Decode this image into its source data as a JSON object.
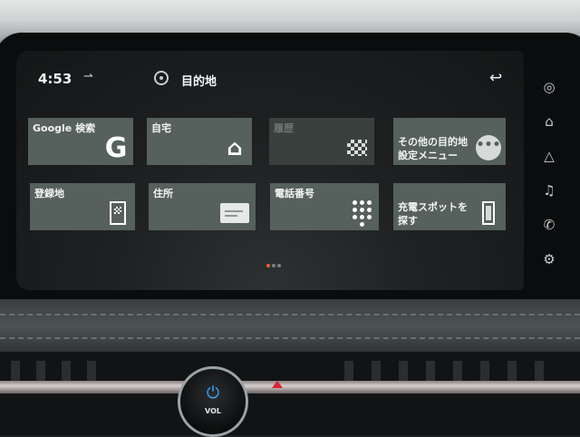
{
  "status_bar": {
    "time": "4:53",
    "title": "目的地",
    "car_icon": "car-icon",
    "nav_icon": "navigation-icon",
    "back_icon": "back-arrow-icon"
  },
  "tiles": [
    {
      "label": "Google 検索",
      "icon": "google-g-icon",
      "enabled": true
    },
    {
      "label": "自宅",
      "icon": "home-icon",
      "enabled": true
    },
    {
      "label": "履歴",
      "icon": "checkered-flag-icon",
      "enabled": false
    },
    {
      "label": "その他の目的地\n設定メニュー",
      "icon": "more-dots-icon",
      "enabled": true
    },
    {
      "label": "登録地",
      "icon": "address-book-icon",
      "enabled": true
    },
    {
      "label": "住所",
      "icon": "address-card-icon",
      "enabled": true
    },
    {
      "label": "電話番号",
      "icon": "keypad-icon",
      "enabled": true
    },
    {
      "label": "充電スポットを\n探す",
      "icon": "charging-station-icon",
      "enabled": true
    }
  ],
  "pagination": {
    "total": 3,
    "active": 1
  },
  "side_rail": [
    {
      "name": "map-icon"
    },
    {
      "name": "home-icon"
    },
    {
      "name": "navigation-arrow-icon"
    },
    {
      "name": "music-icon"
    },
    {
      "name": "phone-icon"
    },
    {
      "name": "vehicle-settings-icon"
    }
  ],
  "hardware": {
    "power_symbol": "⏻",
    "volume_label": "VOL"
  },
  "colors": {
    "tile_bg": "#56605c",
    "tile_disabled_bg": "#3a403e",
    "pagination_active": "#e0672b",
    "text": "#f2f4f5"
  }
}
